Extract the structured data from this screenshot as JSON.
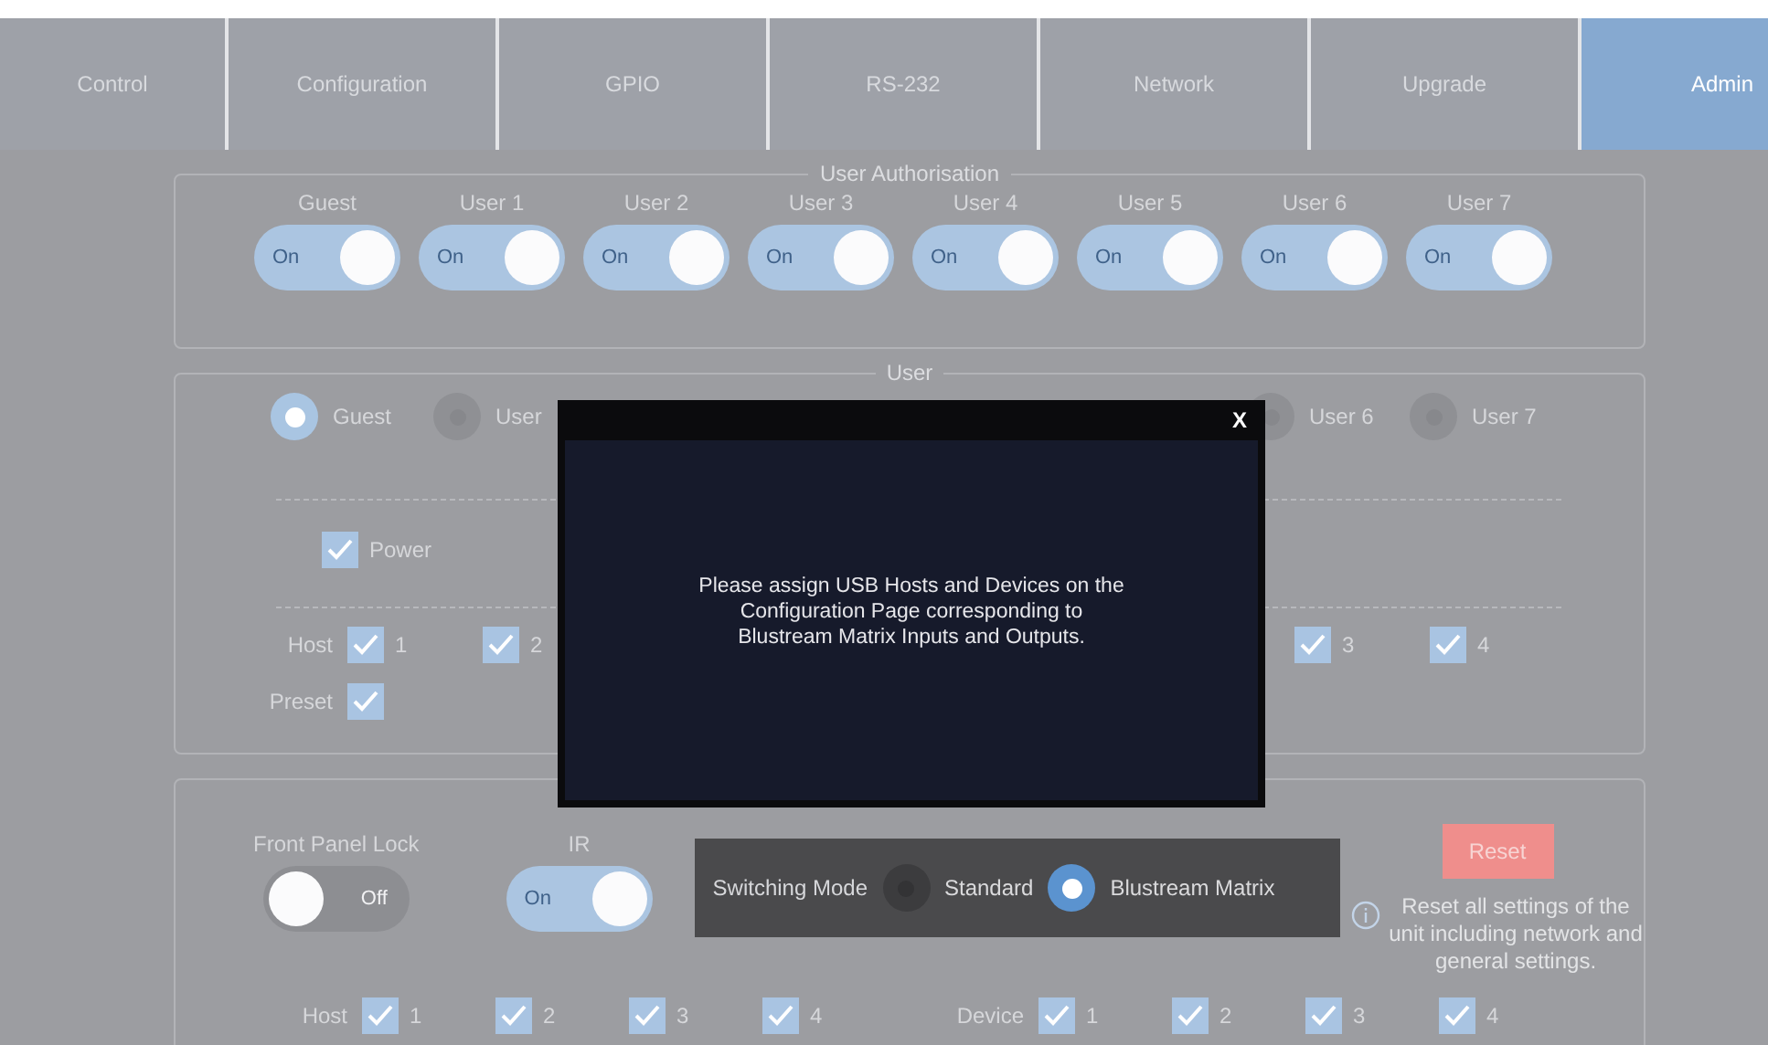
{
  "tabs": [
    {
      "label": "Control",
      "selected": false
    },
    {
      "label": "Configuration",
      "selected": false
    },
    {
      "label": "GPIO",
      "selected": false
    },
    {
      "label": "RS-232",
      "selected": false
    },
    {
      "label": "Network",
      "selected": false
    },
    {
      "label": "Upgrade",
      "selected": false
    },
    {
      "label": "Admin",
      "selected": true
    }
  ],
  "user_authorisation": {
    "title": "User Authorisation",
    "users": [
      {
        "label": "Guest",
        "on": true,
        "state_label": "On"
      },
      {
        "label": "User 1",
        "on": true,
        "state_label": "On"
      },
      {
        "label": "User 2",
        "on": true,
        "state_label": "On"
      },
      {
        "label": "User 3",
        "on": true,
        "state_label": "On"
      },
      {
        "label": "User 4",
        "on": true,
        "state_label": "On"
      },
      {
        "label": "User 5",
        "on": true,
        "state_label": "On"
      },
      {
        "label": "User 6",
        "on": true,
        "state_label": "On"
      },
      {
        "label": "User 7",
        "on": true,
        "state_label": "On"
      }
    ]
  },
  "user": {
    "title": "User",
    "radios": [
      {
        "label": "Guest",
        "selected": true
      },
      {
        "label": "User",
        "selected": false
      },
      {
        "label": "User 6",
        "selected": false
      },
      {
        "label": "User 7",
        "selected": false
      }
    ],
    "power": {
      "label": "Power",
      "checked": true
    },
    "host": {
      "label": "Host",
      "items": [
        {
          "label": "1",
          "checked": true
        },
        {
          "label": "2",
          "checked": true
        },
        {
          "label": "3",
          "checked": true
        },
        {
          "label": "4",
          "checked": true
        }
      ]
    },
    "preset": {
      "label": "Preset",
      "checked": true
    }
  },
  "general": {
    "front_panel_lock": {
      "label": "Front Panel Lock",
      "on": false,
      "state_label": "Off"
    },
    "ir": {
      "label": "IR",
      "on": true,
      "state_label": "On"
    },
    "switching_mode": {
      "label": "Switching Mode",
      "options": [
        {
          "label": "Standard",
          "selected": false
        },
        {
          "label": "Blustream Matrix",
          "selected": true
        }
      ]
    },
    "reset": {
      "button": "Reset",
      "info": "Reset all settings of the unit including network and general settings."
    },
    "host": {
      "label": "Host",
      "items": [
        {
          "label": "1",
          "checked": true
        },
        {
          "label": "2",
          "checked": true
        },
        {
          "label": "3",
          "checked": true
        },
        {
          "label": "4",
          "checked": true
        }
      ]
    },
    "device": {
      "label": "Device",
      "items": [
        {
          "label": "1",
          "checked": true
        },
        {
          "label": "2",
          "checked": true
        },
        {
          "label": "3",
          "checked": true
        },
        {
          "label": "4",
          "checked": true
        }
      ]
    }
  },
  "modal": {
    "close": "X",
    "message": "Please assign USB Hosts and Devices on the Configuration Page corresponding to Blustream Matrix Inputs and Outputs."
  }
}
